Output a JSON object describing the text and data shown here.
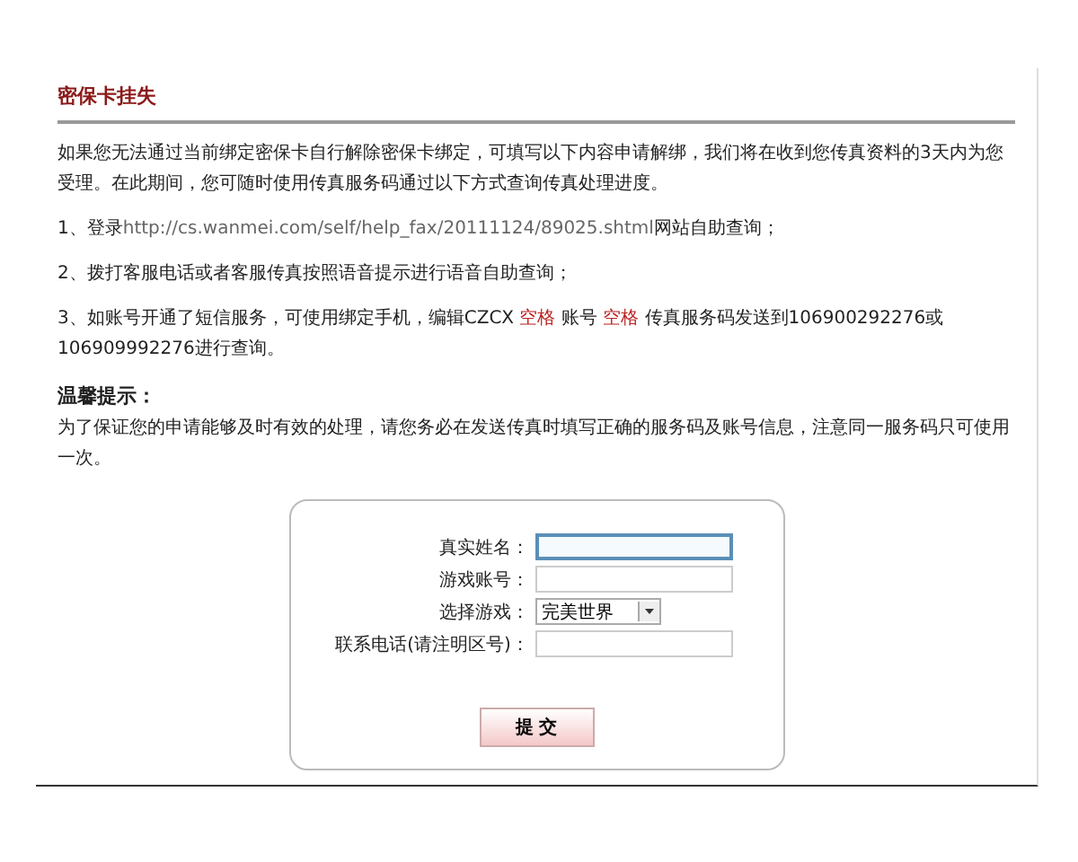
{
  "title": "密保卡挂失",
  "intro": "如果您无法通过当前绑定密保卡自行解除密保卡绑定，可填写以下内容申请解绑，我们将在收到您传真资料的3天内为您受理。在此期间，您可随时使用传真服务码通过以下方式查询传真处理进度。",
  "steps": [
    {
      "parts": [
        {
          "kind": "text",
          "text": "1、登录"
        },
        {
          "kind": "link",
          "text": "http://cs.wanmei.com/self/help_fax/20111124/89025.shtml"
        },
        {
          "kind": "text",
          "text": "网站自助查询；"
        }
      ]
    },
    {
      "parts": [
        {
          "kind": "text",
          "text": "2、拨打客服电话或者客服传真按照语音提示进行语音自助查询；"
        }
      ]
    },
    {
      "parts": [
        {
          "kind": "text",
          "text": "3、如账号开通了短信服务，可使用绑定手机，编辑CZCX "
        },
        {
          "kind": "highlight",
          "text": "空格"
        },
        {
          "kind": "text",
          "text": " 账号 "
        },
        {
          "kind": "highlight",
          "text": "空格"
        },
        {
          "kind": "text",
          "text": " 传真服务码发送到106900292276或106909992276进行查询。"
        }
      ]
    }
  ],
  "tip": {
    "heading": "温馨提示：",
    "text": "为了保证您的申请能够及时有效的处理，请您务必在发送传真时填写正确的服务码及账号信息，注意同一服务码只可使用一次。"
  },
  "form": {
    "fields": [
      {
        "kind": "input",
        "label": "真实姓名：",
        "focused": true
      },
      {
        "kind": "input",
        "label": "游戏账号：",
        "focused": false
      },
      {
        "kind": "select",
        "label": "选择游戏：",
        "value": "完美世界"
      },
      {
        "kind": "input",
        "label": "联系电话(请注明区号)：",
        "focused": false
      }
    ],
    "submit": "提 交"
  }
}
